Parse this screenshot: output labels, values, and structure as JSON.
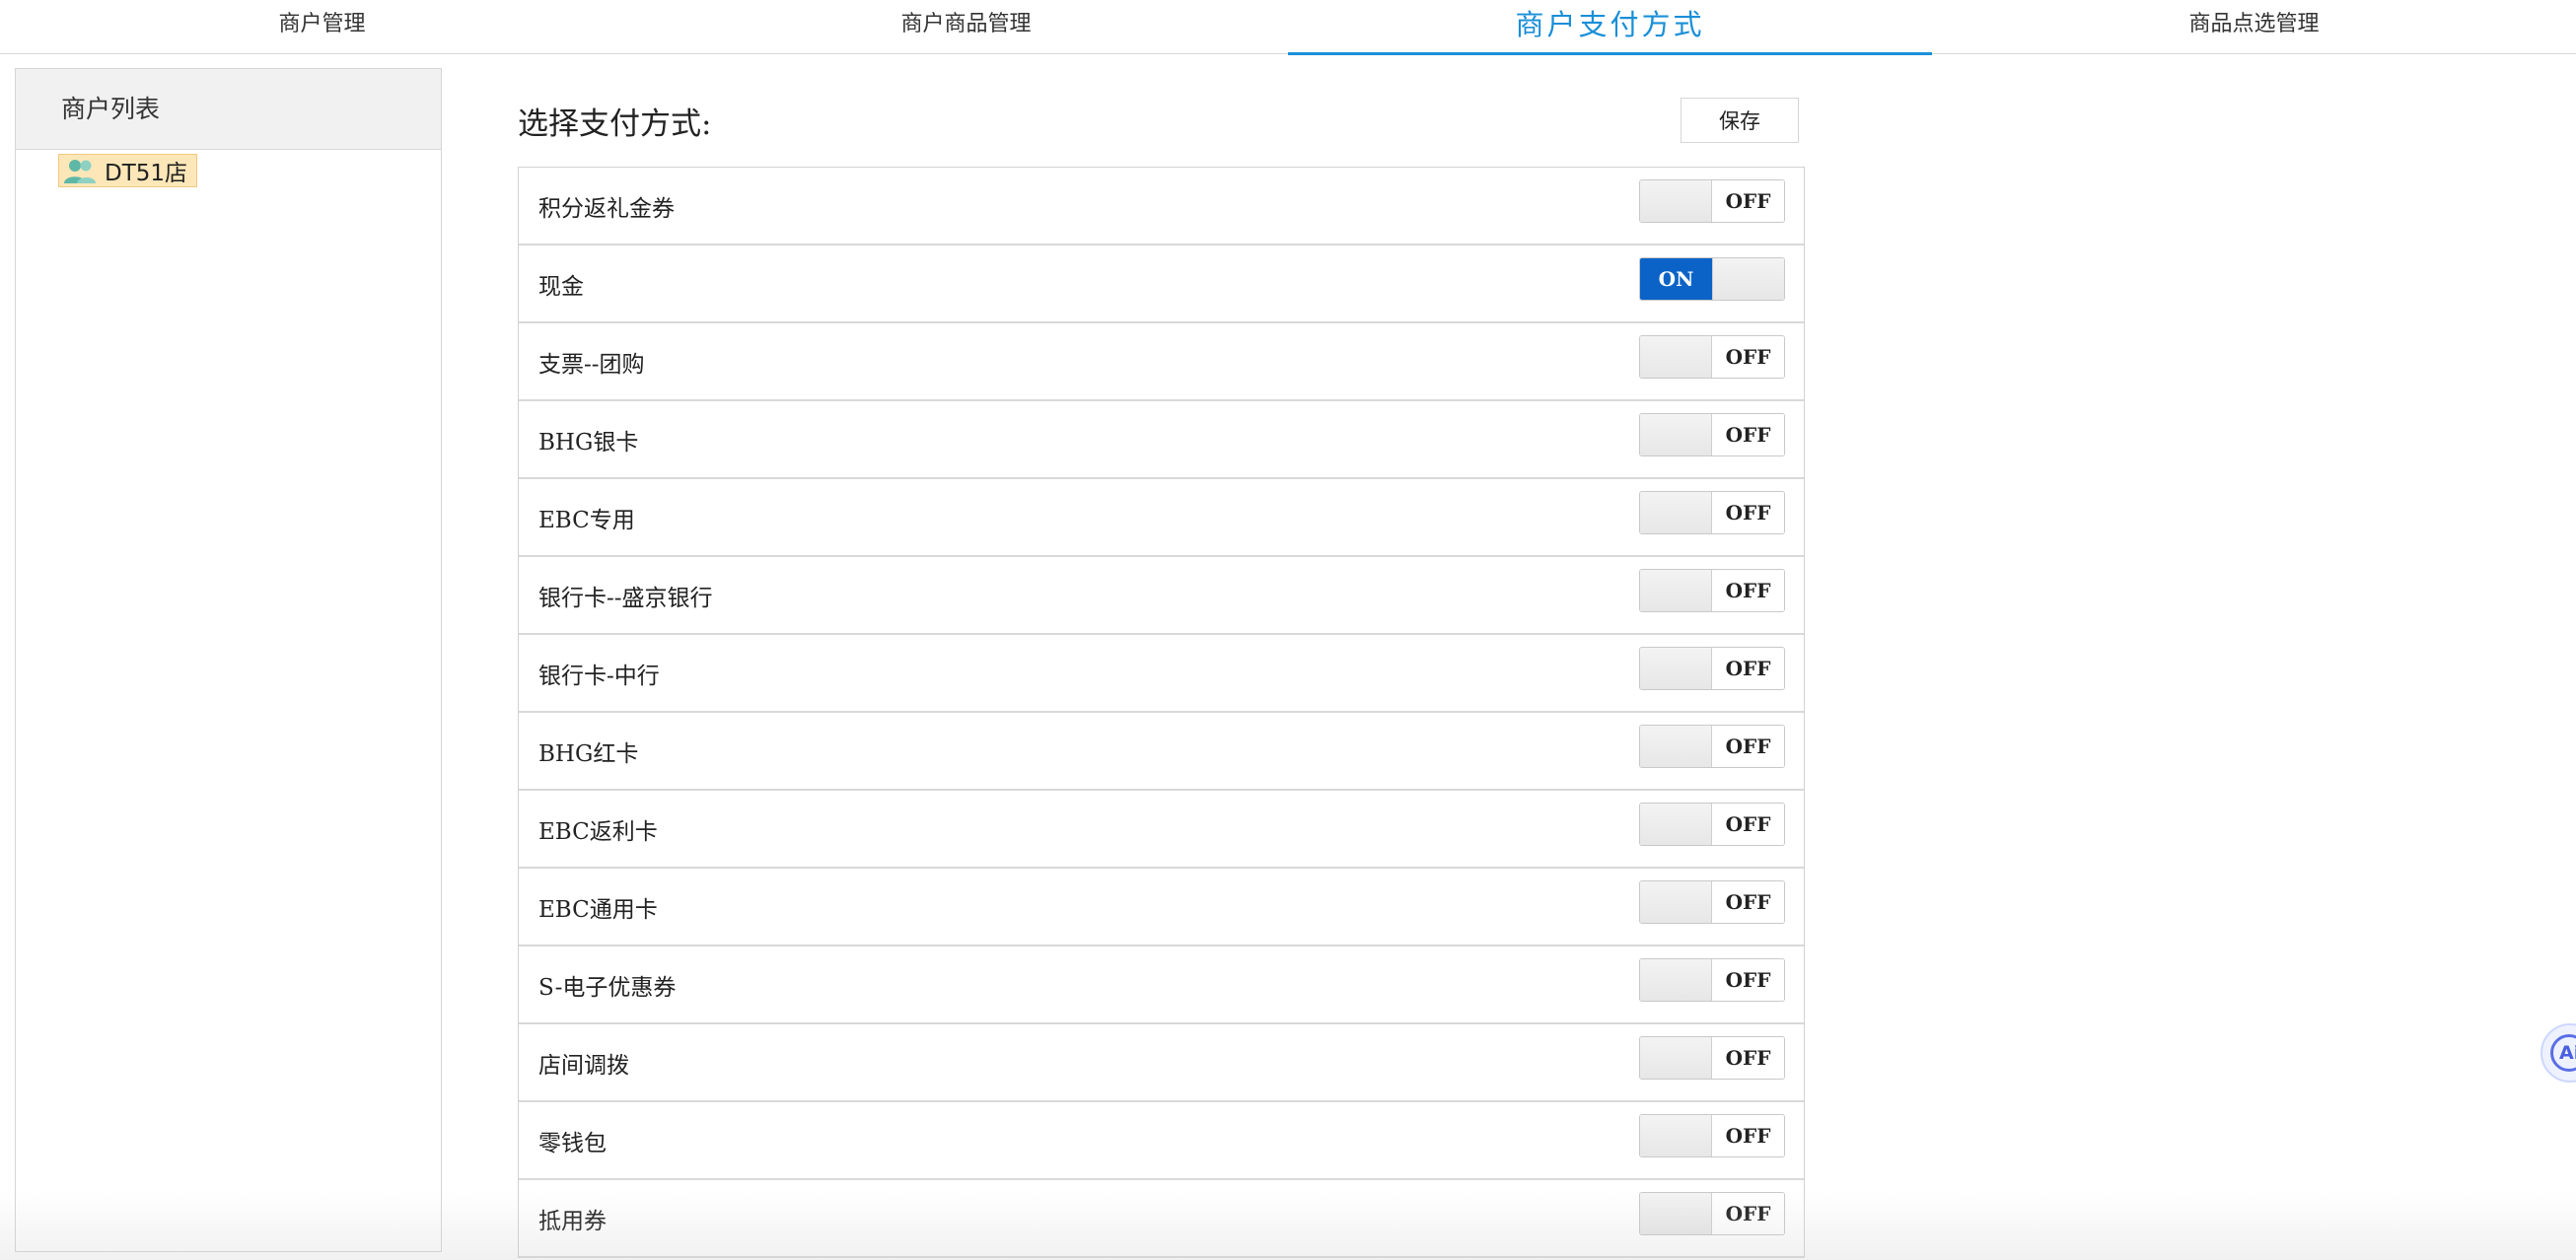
{
  "nav": {
    "tabs": [
      {
        "label": "商户管理",
        "active": false
      },
      {
        "label": "商户商品管理",
        "active": false
      },
      {
        "label": "商户支付方式",
        "active": true
      },
      {
        "label": "商品点选管理",
        "active": false
      }
    ]
  },
  "sidebar": {
    "title": "商户列表",
    "nodes": [
      {
        "label": "DT51店",
        "icon": "users-icon"
      }
    ]
  },
  "main": {
    "title": "选择支付方式:",
    "save_label": "保存",
    "payment_methods": [
      {
        "label": "积分返礼金券",
        "state": "OFF"
      },
      {
        "label": "现金",
        "state": "ON"
      },
      {
        "label": "支票--团购",
        "state": "OFF"
      },
      {
        "label": "BHG银卡",
        "state": "OFF"
      },
      {
        "label": "EBC专用",
        "state": "OFF"
      },
      {
        "label": "银行卡--盛京银行",
        "state": "OFF"
      },
      {
        "label": "银行卡-中行",
        "state": "OFF"
      },
      {
        "label": "BHG红卡",
        "state": "OFF"
      },
      {
        "label": "EBC返利卡",
        "state": "OFF"
      },
      {
        "label": "EBC通用卡",
        "state": "OFF"
      },
      {
        "label": "S-电子优惠券",
        "state": "OFF"
      },
      {
        "label": "店间调拨",
        "state": "OFF"
      },
      {
        "label": "零钱包",
        "state": "OFF"
      },
      {
        "label": "抵用券",
        "state": "OFF"
      }
    ]
  },
  "assistant": {
    "icon": "ai-assistant-icon",
    "label": "Ai"
  },
  "colors": {
    "accent": "#1a8fd8",
    "switch_on": "#0b63c7",
    "node_highlight": "#fde7b8"
  }
}
